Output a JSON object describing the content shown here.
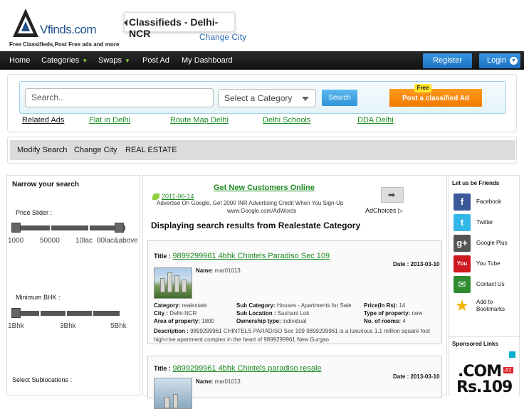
{
  "header": {
    "logo_text": "Vfinds.com",
    "tagline": "Free Classifieds,Post Free ads and more",
    "city_title": "Classifieds - Delhi-NCR",
    "change_city": "Change City"
  },
  "nav": {
    "items": [
      "Home",
      "Categories",
      "Swaps",
      "Post Ad",
      "My Dashboard"
    ],
    "register": "Register",
    "login": "Login"
  },
  "search": {
    "placeholder": "Search..",
    "category_placeholder": "Select a Category",
    "search_button": "Search",
    "post_button": "Post a classified Ad",
    "free_badge": "Free"
  },
  "related": {
    "label": "Related Ads",
    "links": [
      "Flat in Delhi",
      "Route Map Delhi",
      "Delhi Schools",
      "DDA Delhi"
    ]
  },
  "modify_bar": {
    "items": [
      "Modify Search",
      "Change City",
      "REAL ESTATE"
    ]
  },
  "left_panel": {
    "title": "Narrow your search",
    "price_slider_label": "Price Slider :",
    "price_ticks": [
      "1000",
      "50000",
      "10lac",
      "80lac&above"
    ],
    "bhk_label": "Minimum BHK :",
    "bhk_ticks": [
      "1Bhk",
      "3Bhk",
      "5Bhk"
    ],
    "sublocations_label": "Select Sublocations :"
  },
  "ad": {
    "title": "Get New Customers Online",
    "date": "2011-06-14",
    "text": "Advertise On Google. Get 2000 INR Advertising Credit When You Sign-Up",
    "url": "www.Google.com/AdWords",
    "adchoices": "AdChoices"
  },
  "results": {
    "heading": "Displaying search results from Realestate Category",
    "listings": [
      {
        "title_label": "Title :",
        "title": "9899299961 4bhk Chintels Paradiso Sec 109",
        "date_label": "Date :",
        "date": "2013-03-10",
        "name_label": "Name:",
        "name": "mar01013",
        "category_label": "Category:",
        "category": "realestate",
        "city_label": "City :",
        "city": "Delhi-NCR",
        "area_label": "Area of property:",
        "area": "1800",
        "subcat_label": "Sub Category:",
        "subcat": "Houses - Apartments for Sale",
        "subloc_label": "Sub Location :",
        "subloc": "Sushant Lok",
        "ownership_label": "Ownership type:",
        "ownership": "individual",
        "price_label": "Price(In Rs):",
        "price": "14",
        "type_label": "Type of property:",
        "type": "new",
        "rooms_label": "No. of rooms:",
        "rooms": "4",
        "desc_label": "Description :",
        "description": "9899299961 CHINTELS PARADISO Sec 109 9899299961 is a luxurious 1.1 million square foot high-rise apartment complex in the heart of 9899299961 New Gurgao"
      },
      {
        "title_label": "Title :",
        "title": "9899299961 4bhk Chintels paradiso resale",
        "date_label": "Date :",
        "date": "2013-03-10",
        "name_label": "Name:",
        "name": "mar01013"
      }
    ]
  },
  "right_panel": {
    "title": "Let us be Friends",
    "social": [
      {
        "label": "Facebook",
        "icon": "facebook-icon",
        "color": "#3b5998"
      },
      {
        "label": "Twitter",
        "icon": "twitter-icon",
        "color": "#33b6e8"
      },
      {
        "label": "Google Plus",
        "icon": "google-plus-icon",
        "color": "#555555"
      },
      {
        "label": "You Tube",
        "icon": "youtube-icon",
        "color": "#cc181e"
      },
      {
        "label": "Contact Us",
        "icon": "mail-icon",
        "color": "#2e8b2e"
      },
      {
        "label": "Add to Bookmarks",
        "icon": "bookmark-star-icon",
        "color": "#f0b400"
      }
    ],
    "sponsored_title": "Sponsored Links",
    "sponsored_ad_line1": ".COM",
    "sponsored_ad_at": "AT",
    "sponsored_ad_line2": "Rs.109"
  }
}
